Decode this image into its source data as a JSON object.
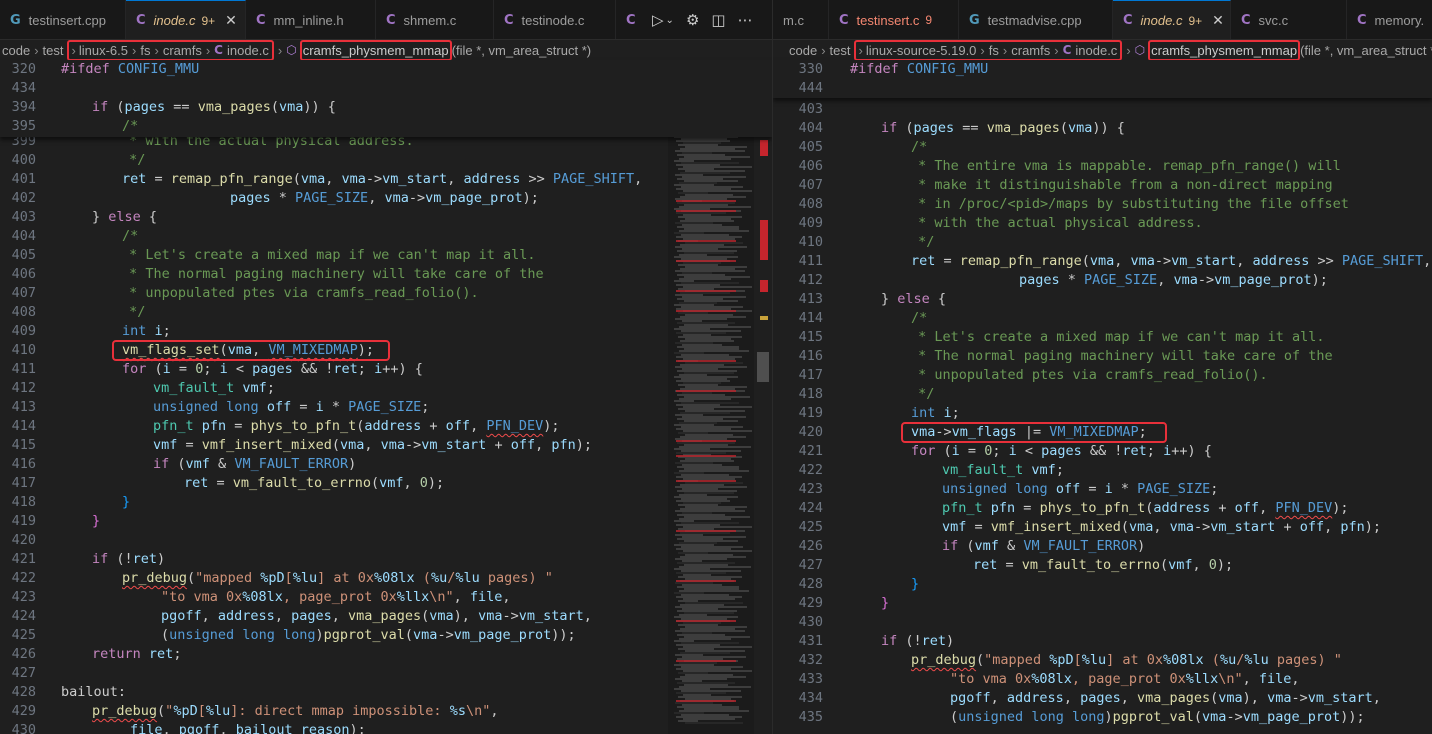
{
  "left": {
    "tabs": [
      {
        "icon": "G",
        "label": "testinsert.cpp",
        "kind": "cpp"
      },
      {
        "icon": "C",
        "label": "inode.c",
        "badge": "9+",
        "active": true,
        "modified": true
      },
      {
        "icon": "C",
        "label": "mm_inline.h",
        "kind": "h"
      },
      {
        "icon": "C",
        "label": "shmem.c"
      },
      {
        "icon": "C",
        "label": "testinode.c"
      },
      {
        "icon": "C",
        "label": ""
      }
    ],
    "tab_close": "✕",
    "breadcrumb": {
      "items": [
        "code",
        "test",
        "linux-6.5",
        "fs",
        "cramfs",
        "inode.c"
      ],
      "symbol": "cramfs_physmem_mmap",
      "params": "(file *, vm_area_struct *)"
    },
    "sticky_lines": [
      {
        "n": "320",
        "text": "#ifdef CONFIG_MMU"
      },
      {
        "n": "434",
        "text": ""
      },
      {
        "n": "394",
        "text": "    if (pages == vma_pages(vma)) {"
      },
      {
        "n": "395",
        "text": "        /*"
      }
    ],
    "line_numbers": [
      "399",
      "400",
      "401",
      "402",
      "403",
      "404",
      "405",
      "406",
      "407",
      "408",
      "409",
      "410",
      "411",
      "412",
      "413",
      "414",
      "415",
      "416",
      "417",
      "418",
      "419",
      "420",
      "421",
      "422",
      "423",
      "424",
      "425",
      "426",
      "427",
      "428",
      "429",
      "430"
    ]
  },
  "right": {
    "tabs": [
      {
        "icon": "",
        "label": "m.c"
      },
      {
        "icon": "C",
        "label": "testinsert.c",
        "badge": "9",
        "error": true
      },
      {
        "icon": "G",
        "label": "testmadvise.cpp"
      },
      {
        "icon": "C",
        "label": "inode.c",
        "badge": "9+",
        "active": true,
        "modified": true
      },
      {
        "icon": "C",
        "label": "svc.c"
      },
      {
        "icon": "C",
        "label": "memory."
      }
    ],
    "breadcrumb": {
      "items": [
        "code",
        "test",
        "linux-source-5.19.0",
        "fs",
        "cramfs",
        "inode.c"
      ],
      "symbol": "cramfs_physmem_mmap",
      "params": "(file *, vm_area_struct *)"
    },
    "sticky_lines": [
      {
        "n": "330",
        "text": "#ifdef CONFIG_MMU"
      },
      {
        "n": "444",
        "text": ""
      }
    ],
    "line_numbers": [
      "403",
      "404",
      "405",
      "406",
      "407",
      "408",
      "409",
      "410",
      "411",
      "412",
      "413",
      "414",
      "415",
      "416",
      "417",
      "418",
      "419",
      "420",
      "421",
      "422",
      "423",
      "424",
      "425",
      "426",
      "427",
      "428",
      "429",
      "430",
      "431",
      "432",
      "433",
      "434",
      "435"
    ]
  },
  "code": {
    "l_399": " * with the actual physical address.",
    "l_400": " */",
    "remap": "remap_pfn_range",
    "remap_args": "(vma, vma->vm_start, address >> ",
    "page_shift": "PAGE_SHIFT",
    "pages_size": "pages * ",
    "page_size": "PAGE_SIZE",
    "prot": ", vma->vm_page_prot);",
    "else": "} else {",
    "c_open": "/*",
    "c_mixed1": " * Let's create a mixed map if we can't map it all.",
    "c_mixed2": " * The normal paging machinery will take care of the",
    "c_mixed3": " * unpopulated ptes via cramfs_read_folio().",
    "c_close": " */",
    "int_i": "int i;",
    "left_flags": "vm_flags_set(vma, VM_MIXEDMAP);",
    "right_flags": "vma->vm_flags |= VM_MIXEDMAP;",
    "for_loop": "for (i = 0; i < pages && !ret; i++) {",
    "fault_decl": "vm_fault_t vmf;",
    "off_decl": "unsigned long off = i * PAGE_SIZE;",
    "pfn_decl": "pfn_t pfn = phys_to_pfn_t(address + off, PFN_DEV);",
    "insert": "vmf = vmf_insert_mixed(vma, vma->vm_start + off, pfn);",
    "if_err": "if (vmf & VM_FAULT_ERROR)",
    "ret_err": "ret = vm_fault_to_errno(vmf, 0);",
    "close": "}",
    "if_ret": "if (!ret)",
    "dbg1": "pr_debug(\"mapped %pD[%lu] at 0x%08lx (%u/%lu pages) \"",
    "dbg2": "\"to vma 0x%08lx, page_prot 0x%llx\\n\", file,",
    "dbg3": "pgoff, address, pages, vma_pages(vma), vma->vm_start,",
    "dbg4": "(unsigned long long)pgprot_val(vma->vm_page_prot));",
    "return": "return ret;",
    "bailout": "bailout:",
    "dbg5": "pr_debug(\"%pD[%lu]: direct mmap impossible: %s\\n\",",
    "dbg6": "file, pgoff, bailout_reason);",
    "r_if": "if (pages == vma_pages(vma)) {",
    "r_c1": " * The entire vma is mappable. remap_pfn_range() will",
    "r_c2": " * make it distinguishable from a non-direct mapping",
    "r_c3": " * in /proc/<pid>/maps by substituting the file offset",
    "r_c4": " * with the actual physical address."
  }
}
